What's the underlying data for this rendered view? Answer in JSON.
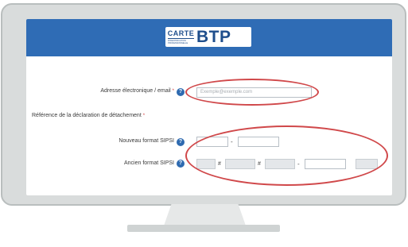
{
  "logo": {
    "carte": "CARTE",
    "carte_sub": "D'IDENTIFICATION PROFESSIONNELLE",
    "btp": "BTP"
  },
  "form": {
    "email": {
      "label": "Adresse électronique / email",
      "required_mark": "*",
      "help_icon": "?",
      "placeholder": "Exemple@exemple.com"
    },
    "declaration": {
      "label": "Référence de la déclaration de détachement",
      "required_mark": "*"
    },
    "nouveau": {
      "label": "Nouveau format SIPSI",
      "help_icon": "?",
      "separator": "-"
    },
    "ancien": {
      "label": "Ancien format SIPSI",
      "help_icon": "?",
      "separator1": "#",
      "separator2": "#",
      "separator3": "-"
    }
  },
  "annotation_color": "#d0484a",
  "brand_color": "#2f6cb5"
}
